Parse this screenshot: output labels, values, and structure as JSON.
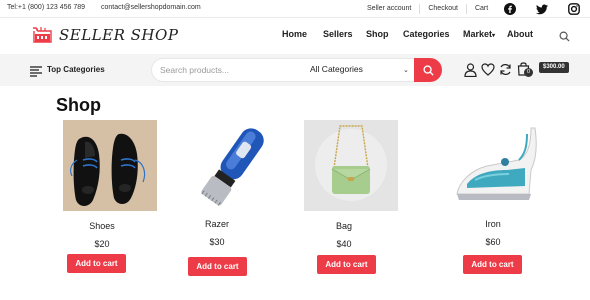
{
  "topbar": {
    "phone": "Tel:+1 (800) 123 456 789",
    "email": "contact@sellershopdomain.com",
    "links": [
      "Seller account",
      "Checkout",
      "Cart"
    ],
    "social_icons": [
      "facebook-icon",
      "twitter-icon",
      "instagram-icon"
    ]
  },
  "header": {
    "logo_text": "SELLER SHOP",
    "nav": [
      {
        "label": "Home"
      },
      {
        "label": "Sellers"
      },
      {
        "label": "Shop"
      },
      {
        "label": "Categories"
      },
      {
        "label": "Market"
      },
      {
        "label": "About"
      }
    ]
  },
  "catbar": {
    "label": "Top Categories",
    "search_placeholder": "Search products...",
    "category_select": "All Categories",
    "cart_count": "0",
    "cart_total": "$300.00"
  },
  "page": {
    "title": "Shop"
  },
  "products": [
    {
      "name": "Shoes",
      "price": "$20",
      "button": "Add to cart"
    },
    {
      "name": "Razer",
      "price": "$30",
      "button": "Add to cart"
    },
    {
      "name": "Bag",
      "price": "$40",
      "button": "Add to cart"
    },
    {
      "name": "Iron",
      "price": "$60",
      "button": "Add to cart"
    }
  ],
  "colors": {
    "accent": "#ed3b47",
    "dark": "#333333",
    "bar_bg": "#f4f4f4"
  }
}
